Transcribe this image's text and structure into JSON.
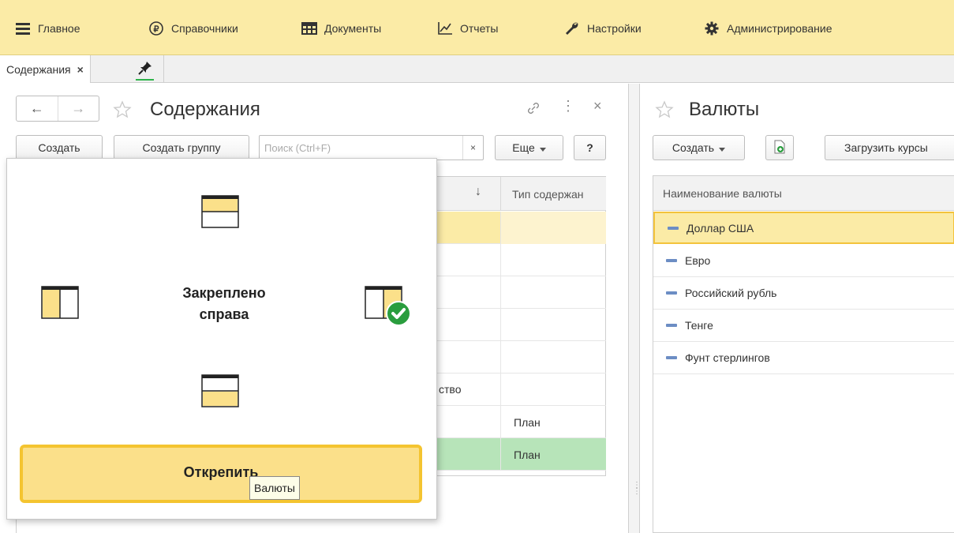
{
  "menu": {
    "items": [
      {
        "label": "Главное",
        "icon": "hamburger-icon"
      },
      {
        "label": "Справочники",
        "icon": "ruble-icon"
      },
      {
        "label": "Документы",
        "icon": "table-icon"
      },
      {
        "label": "Отчеты",
        "icon": "chart-icon"
      },
      {
        "label": "Настройки",
        "icon": "wrench-icon"
      },
      {
        "label": "Администрирование",
        "icon": "gear-icon"
      }
    ]
  },
  "tabs": {
    "active_label": "Содержания",
    "close_glyph": "×",
    "pin_glyph": "pin-icon"
  },
  "left": {
    "nav_back": "←",
    "nav_forward": "→",
    "title": "Содержания",
    "link_glyph": "🔗",
    "more_glyph": "⋮",
    "close_glyph": "×",
    "buttons": {
      "create": "Создать",
      "create_group": "Создать группу",
      "more": "Еще",
      "help": "?"
    },
    "search_placeholder": "Поиск (Ctrl+F)",
    "search_clear": "×",
    "table": {
      "sort_arrow": "↓",
      "col_type": "Тип содержан",
      "rows": [
        {
          "c1": "",
          "c2": ""
        },
        {
          "c1": "",
          "c2": ""
        },
        {
          "c1": "",
          "c2": ""
        },
        {
          "c1": "",
          "c2": ""
        },
        {
          "c1": "",
          "c2": ""
        },
        {
          "c1": "ство",
          "c2": ""
        },
        {
          "c1": "",
          "c2": "План"
        },
        {
          "c1": "",
          "c2": "План"
        }
      ]
    }
  },
  "popup": {
    "caption_line1": "Закреплено",
    "caption_line2": "справа",
    "unpin_label": "Открепить",
    "tooltip": "Валюты"
  },
  "right": {
    "title": "Валюты",
    "buttons": {
      "create": "Создать",
      "load_rates": "Загрузить курсы"
    },
    "table": {
      "header": "Наименование валюты",
      "rows": [
        "Доллар США",
        "Евро",
        "Российский рубль",
        "Тенге",
        "Фунт стерлингов"
      ]
    }
  },
  "colors": {
    "menu_bg": "#fbeba6",
    "selection": "#fbeba6",
    "selection_border": "#f3c33b",
    "green_row": "#b7e4b9",
    "check_green": "#2a9d3e"
  }
}
